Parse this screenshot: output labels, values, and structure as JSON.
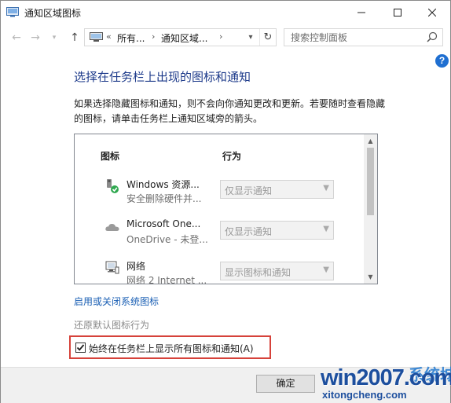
{
  "window": {
    "title": "通知区域图标",
    "minimize_glyph": "—",
    "maximize_glyph": "☐",
    "close_glyph": "✕"
  },
  "navigation": {
    "back_glyph": "←",
    "forward_glyph": "→",
    "recent_glyph": "▾",
    "up_glyph": "↑",
    "breadcrumb": [
      "«",
      "所有...",
      "›",
      "通知区域...",
      "›"
    ],
    "dropdown_glyph": "▾",
    "refresh_glyph": "↻",
    "search_placeholder": "搜索控制面板"
  },
  "help_label": "?",
  "page": {
    "title": "选择在任务栏上出现的图标和通知",
    "description": "如果选择隐藏图标和通知，则不会向你通知更改和更新。若要随时查看隐藏的图标，请单击任务栏上通知区域旁的箭头。",
    "columns": {
      "icon": "图标",
      "behavior": "行为"
    },
    "rows": [
      {
        "icon": "usb-eject-icon",
        "name": "Windows 资源...",
        "sub": "安全删除硬件并...",
        "behavior": "仅显示通知"
      },
      {
        "icon": "onedrive-cloud-icon",
        "name": "Microsoft One...",
        "sub": "OneDrive - 未登...",
        "behavior": "仅显示通知"
      },
      {
        "icon": "network-icon",
        "name": "网络",
        "sub": "网络  2 Internet ...",
        "behavior": "显示图标和通知"
      }
    ],
    "system_icons_link": "启用或关闭系统图标",
    "restore_default": "还原默认图标行为",
    "always_show_label": "始终在任务栏上显示所有图标和通知(A)",
    "always_show_checked": true,
    "ok_label": "确定"
  },
  "watermark": {
    "main": "win2007.com",
    "cn": "系统城",
    "url": "xitongcheng.com"
  },
  "colors": {
    "title_blue": "#1e3b8b",
    "link_blue": "#1a5fb4",
    "highlight_red": "#d6423a",
    "help_blue": "#1f6fd1"
  }
}
